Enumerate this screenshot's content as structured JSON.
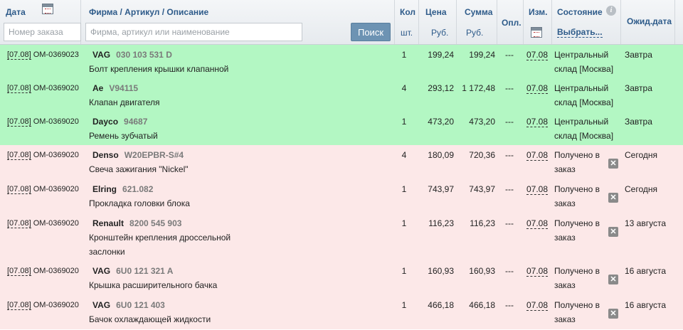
{
  "header": {
    "date": "Дата",
    "firm": "Фирма / Артикул / Описание",
    "qty": "Кол",
    "qty_unit": "шт.",
    "price": "Цена",
    "price_unit": "Руб.",
    "sum": "Сумма",
    "sum_unit": "Руб.",
    "paid": "Опл.",
    "changed": "Изм.",
    "state": "Состояние",
    "state_select": "Выбрать...",
    "expected": "Ожид.дата",
    "order_placeholder": "Номер заказа",
    "search_placeholder": "Фирма, артикул или наименование",
    "search_button": "Поиск"
  },
  "rows": [
    {
      "status": "ok",
      "date": "[07.08]",
      "order": "OM-0369023",
      "brand": "VAG",
      "article": "030 103 531 D",
      "desc1": "Болт крепления крышки клапанной",
      "desc2": "",
      "qty": "1",
      "price": "199,24",
      "sum": "199,24",
      "paid": "---",
      "changed": "07.08",
      "state1": "Центральный",
      "state2": "склад [Москва]",
      "expected": "Завтра",
      "removable": false
    },
    {
      "status": "ok",
      "date": "[07.08]",
      "order": "OM-0369020",
      "brand": "Ae",
      "article": "V94115",
      "desc1": "Клапан двигателя",
      "desc2": "",
      "qty": "4",
      "price": "293,12",
      "sum": "1 172,48",
      "paid": "---",
      "changed": "07.08",
      "state1": "Центральный",
      "state2": "склад [Москва]",
      "expected": "Завтра",
      "removable": false
    },
    {
      "status": "ok",
      "date": "[07.08]",
      "order": "OM-0369020",
      "brand": "Dayco",
      "article": "94687",
      "desc1": "Ремень зубчатый",
      "desc2": "",
      "qty": "1",
      "price": "473,20",
      "sum": "473,20",
      "paid": "---",
      "changed": "07.08",
      "state1": "Центральный",
      "state2": "склад [Москва]",
      "expected": "Завтра",
      "removable": false
    },
    {
      "status": "pend",
      "date": "[07.08]",
      "order": "OM-0369020",
      "brand": "Denso",
      "article": "W20EPBR-S#4",
      "desc1": "Свеча зажигания \"Nickel\"",
      "desc2": "",
      "qty": "4",
      "price": "180,09",
      "sum": "720,36",
      "paid": "---",
      "changed": "07.08",
      "state1": "Получено в",
      "state2": "заказ",
      "expected": "Сегодня",
      "removable": true
    },
    {
      "status": "pend",
      "date": "[07.08]",
      "order": "OM-0369020",
      "brand": "Elring",
      "article": "621.082",
      "desc1": "Прокладка головки блока",
      "desc2": "",
      "qty": "1",
      "price": "743,97",
      "sum": "743,97",
      "paid": "---",
      "changed": "07.08",
      "state1": "Получено в",
      "state2": "заказ",
      "expected": "Сегодня",
      "removable": true
    },
    {
      "status": "pend",
      "date": "[07.08]",
      "order": "OM-0369020",
      "brand": "Renault",
      "article": "8200 545 903",
      "desc1": "Кронштейн крепления дроссельной",
      "desc2": "заслонки",
      "qty": "1",
      "price": "116,23",
      "sum": "116,23",
      "paid": "---",
      "changed": "07.08",
      "state1": "Получено в",
      "state2": "заказ",
      "expected": "13 августа",
      "removable": true
    },
    {
      "status": "pend",
      "date": "[07.08]",
      "order": "OM-0369020",
      "brand": "VAG",
      "article": "6U0 121 321 A",
      "desc1": "Крышка расширительного бачка",
      "desc2": "",
      "qty": "1",
      "price": "160,93",
      "sum": "160,93",
      "paid": "---",
      "changed": "07.08",
      "state1": "Получено в",
      "state2": "заказ",
      "expected": "16 августа",
      "removable": true
    },
    {
      "status": "pend",
      "date": "[07.08]",
      "order": "OM-0369020",
      "brand": "VAG",
      "article": "6U0 121 403",
      "desc1": "Бачок охлаждающей жидкости",
      "desc2": "",
      "qty": "1",
      "price": "466,18",
      "sum": "466,18",
      "paid": "---",
      "changed": "07.08",
      "state1": "Получено в",
      "state2": "заказ",
      "expected": "16 августа",
      "removable": true
    }
  ],
  "colors": {
    "ok": "#b3f7c3",
    "pending": "#fce8e8",
    "header_text": "#2e5b8a",
    "button": "#6d93b3"
  },
  "icons": {
    "calendar": "calendar-icon",
    "info": "info-icon",
    "remove": "remove-icon"
  }
}
